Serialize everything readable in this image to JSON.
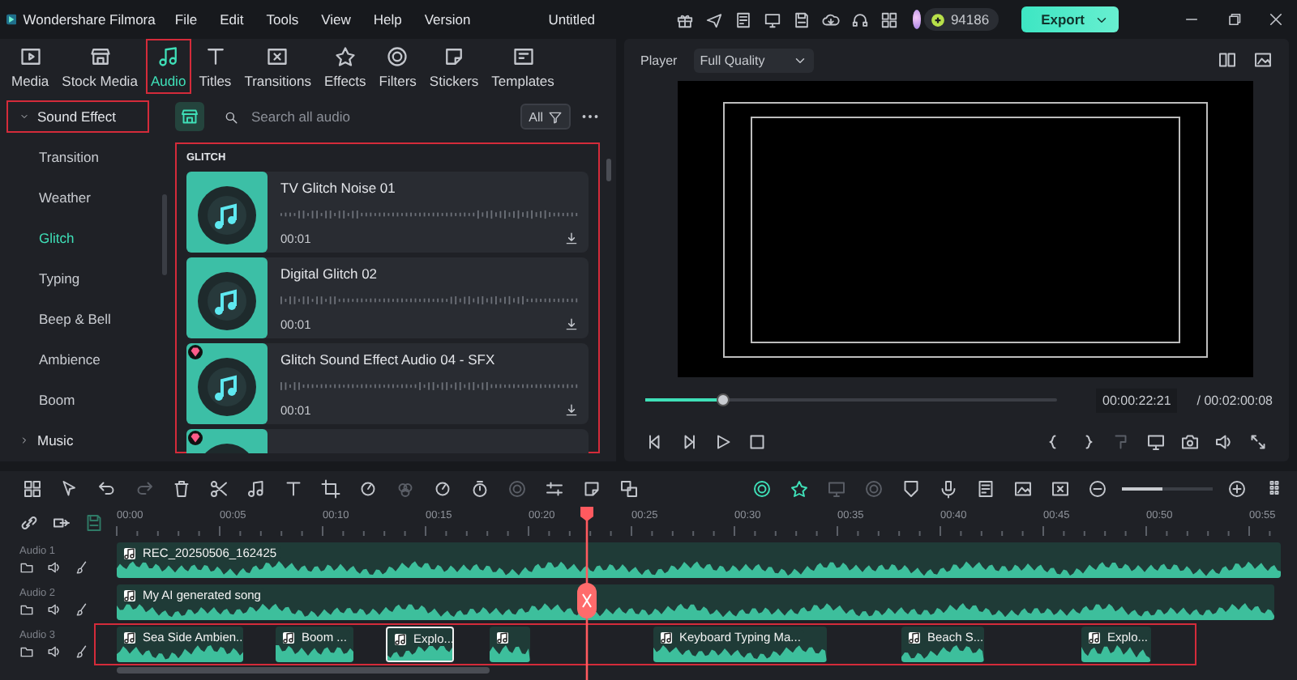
{
  "app": {
    "name": "Wondershare Filmora",
    "menu": [
      "File",
      "Edit",
      "Tools",
      "View",
      "Help",
      "Version"
    ],
    "document_title": "Untitled",
    "credits": "94186",
    "export_label": "Export"
  },
  "media_tabs": [
    {
      "label": "Media",
      "selected": false,
      "highlighted": false
    },
    {
      "label": "Stock Media",
      "selected": false,
      "highlighted": false
    },
    {
      "label": "Audio",
      "selected": true,
      "highlighted": true
    },
    {
      "label": "Titles",
      "selected": false,
      "highlighted": false
    },
    {
      "label": "Transitions",
      "selected": false,
      "highlighted": false
    },
    {
      "label": "Effects",
      "selected": false,
      "highlighted": false
    },
    {
      "label": "Filters",
      "selected": false,
      "highlighted": false
    },
    {
      "label": "Stickers",
      "selected": false,
      "highlighted": false
    },
    {
      "label": "Templates",
      "selected": false,
      "highlighted": false
    }
  ],
  "categories": [
    {
      "label": "Sound Effect",
      "kind": "group",
      "expanded": true,
      "selected": false,
      "highlighted": true
    },
    {
      "label": "Transition",
      "kind": "item",
      "selected": false,
      "highlighted": false
    },
    {
      "label": "Weather",
      "kind": "item",
      "selected": false,
      "highlighted": false
    },
    {
      "label": "Glitch",
      "kind": "item",
      "selected": true,
      "highlighted": false
    },
    {
      "label": "Typing",
      "kind": "item",
      "selected": false,
      "highlighted": false
    },
    {
      "label": "Beep & Bell",
      "kind": "item",
      "selected": false,
      "highlighted": false
    },
    {
      "label": "Ambience",
      "kind": "item",
      "selected": false,
      "highlighted": false
    },
    {
      "label": "Boom",
      "kind": "item",
      "selected": false,
      "highlighted": false
    },
    {
      "label": "Music",
      "kind": "group",
      "expanded": false,
      "selected": false,
      "highlighted": false
    }
  ],
  "search": {
    "placeholder": "Search all audio",
    "filter": "All"
  },
  "library": {
    "section": "GLITCH",
    "highlighted": true,
    "items": [
      {
        "title": "TV Glitch Noise 01",
        "duration": "00:01",
        "premium": false
      },
      {
        "title": "Digital Glitch 02",
        "duration": "00:01",
        "premium": false
      },
      {
        "title": "Glitch Sound Effect Audio 04 - SFX",
        "duration": "00:01",
        "premium": true
      },
      {
        "premium": true
      }
    ]
  },
  "player": {
    "label": "Player",
    "quality": "Full Quality",
    "progress": {
      "level": 0.19
    },
    "current_time": "00:00:22:21",
    "total_time": "/ 00:02:00:08"
  },
  "timeline": {
    "zoom": {
      "level": 0.45
    },
    "ruler": [
      "00:00",
      "00:05",
      "00:10",
      "00:15",
      "00:20",
      "00:25",
      "00:30",
      "00:35",
      "00:40",
      "00:45",
      "00:50",
      "00:55"
    ],
    "tracks": [
      {
        "name": "Audio 1",
        "highlighted": false,
        "clips": [
          {
            "label": "REC_20250506_162425",
            "selected": false
          }
        ]
      },
      {
        "name": "Audio 2",
        "highlighted": false,
        "clips": [
          {
            "label": "My AI generated song",
            "selected": false
          }
        ]
      },
      {
        "name": "Audio 3",
        "highlighted": true,
        "clips": [
          {
            "label": "Sea Side Ambien...",
            "selected": false
          },
          {
            "label": "Boom ...",
            "selected": false
          },
          {
            "label": "Explo...",
            "selected": true
          },
          {
            "selected": false
          },
          {
            "label": "Keyboard Typing Ma...",
            "selected": false
          },
          {
            "label": "Beach S...",
            "selected": false
          },
          {
            "label": "Explo...",
            "selected": false
          }
        ]
      }
    ]
  }
}
